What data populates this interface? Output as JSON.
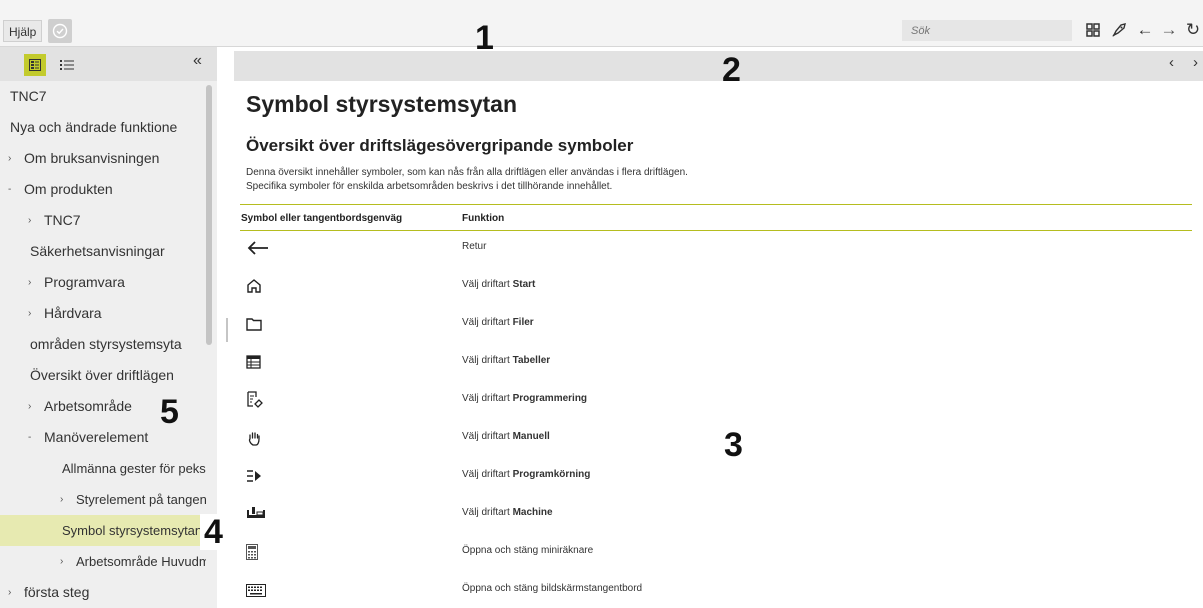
{
  "topbar": {
    "help_label": "Hjälp",
    "search_placeholder": "Sök"
  },
  "sidebar": {
    "items": [
      {
        "label": "TNC7",
        "indent": 0,
        "arrow": ""
      },
      {
        "label": "Nya och ändrade funktione",
        "indent": 0,
        "arrow": ""
      },
      {
        "label": "Om bruksanvisningen",
        "indent": 0,
        "arrow": "›"
      },
      {
        "label": "Om produkten",
        "indent": 0,
        "arrow": "-"
      },
      {
        "label": "TNC7",
        "indent": 1,
        "arrow": "›"
      },
      {
        "label": "Säkerhetsanvisningar",
        "indent": 1,
        "arrow": ""
      },
      {
        "label": "Programvara",
        "indent": 1,
        "arrow": "›"
      },
      {
        "label": "Hårdvara",
        "indent": 1,
        "arrow": "›"
      },
      {
        "label": "områden styrsystemsyta",
        "indent": 1,
        "arrow": ""
      },
      {
        "label": "Översikt över driftlägen",
        "indent": 1,
        "arrow": ""
      },
      {
        "label": "Arbetsområde",
        "indent": 1,
        "arrow": "›"
      },
      {
        "label": "Manöverelement",
        "indent": 1,
        "arrow": "-"
      },
      {
        "label": "Allmänna gester för peksk",
        "indent": 2,
        "arrow": ""
      },
      {
        "label": "Styrelement på tangentbo",
        "indent": 2,
        "arrow": "›"
      },
      {
        "label": "Symbol styrsystemsytan",
        "indent": 2,
        "arrow": "",
        "active": true
      },
      {
        "label": "Arbetsområde Huvudmen",
        "indent": 2,
        "arrow": "›"
      },
      {
        "label": "första steg",
        "indent": 0,
        "arrow": "›"
      }
    ]
  },
  "content": {
    "page_title": "Symbol styrsystemsytan",
    "section_title": "Översikt över driftslägesövergripande symboler",
    "intro_line1": "Denna översikt innehåller symboler, som kan nås från alla driftlägen eller användas i flera driftlägen.",
    "intro_line2": "Specifika symboler för enskilda arbetsområden beskrivs i det tillhörande innehållet.",
    "table": {
      "col_symbol": "Symbol eller tangentbordsgenväg",
      "col_function": "Funktion",
      "rows": [
        {
          "icon": "back-arrow-icon",
          "prefix": "Retur",
          "bold": ""
        },
        {
          "icon": "home-icon",
          "prefix": "Välj driftart ",
          "bold": "Start"
        },
        {
          "icon": "folder-icon",
          "prefix": "Välj driftart ",
          "bold": "Filer"
        },
        {
          "icon": "table-icon",
          "prefix": "Välj driftart ",
          "bold": "Tabeller"
        },
        {
          "icon": "program-edit-icon",
          "prefix": "Välj driftart ",
          "bold": "Programmering"
        },
        {
          "icon": "hand-icon",
          "prefix": "Välj driftart ",
          "bold": "Manuell"
        },
        {
          "icon": "program-run-icon",
          "prefix": "Välj driftart ",
          "bold": "Programkörning"
        },
        {
          "icon": "machine-icon",
          "prefix": "Välj driftart ",
          "bold": "Machine"
        },
        {
          "icon": "calculator-icon",
          "prefix": "Öppna och stäng miniräknare",
          "bold": ""
        },
        {
          "icon": "keyboard-icon",
          "prefix": "Öppna och stäng bildskärmstangentbord",
          "bold": ""
        }
      ]
    }
  },
  "callouts": [
    "1",
    "2",
    "3",
    "4",
    "5"
  ],
  "colors": {
    "accent": "#c3cb2d",
    "active_item": "#e7eab1",
    "rule": "#b5bd1f"
  }
}
